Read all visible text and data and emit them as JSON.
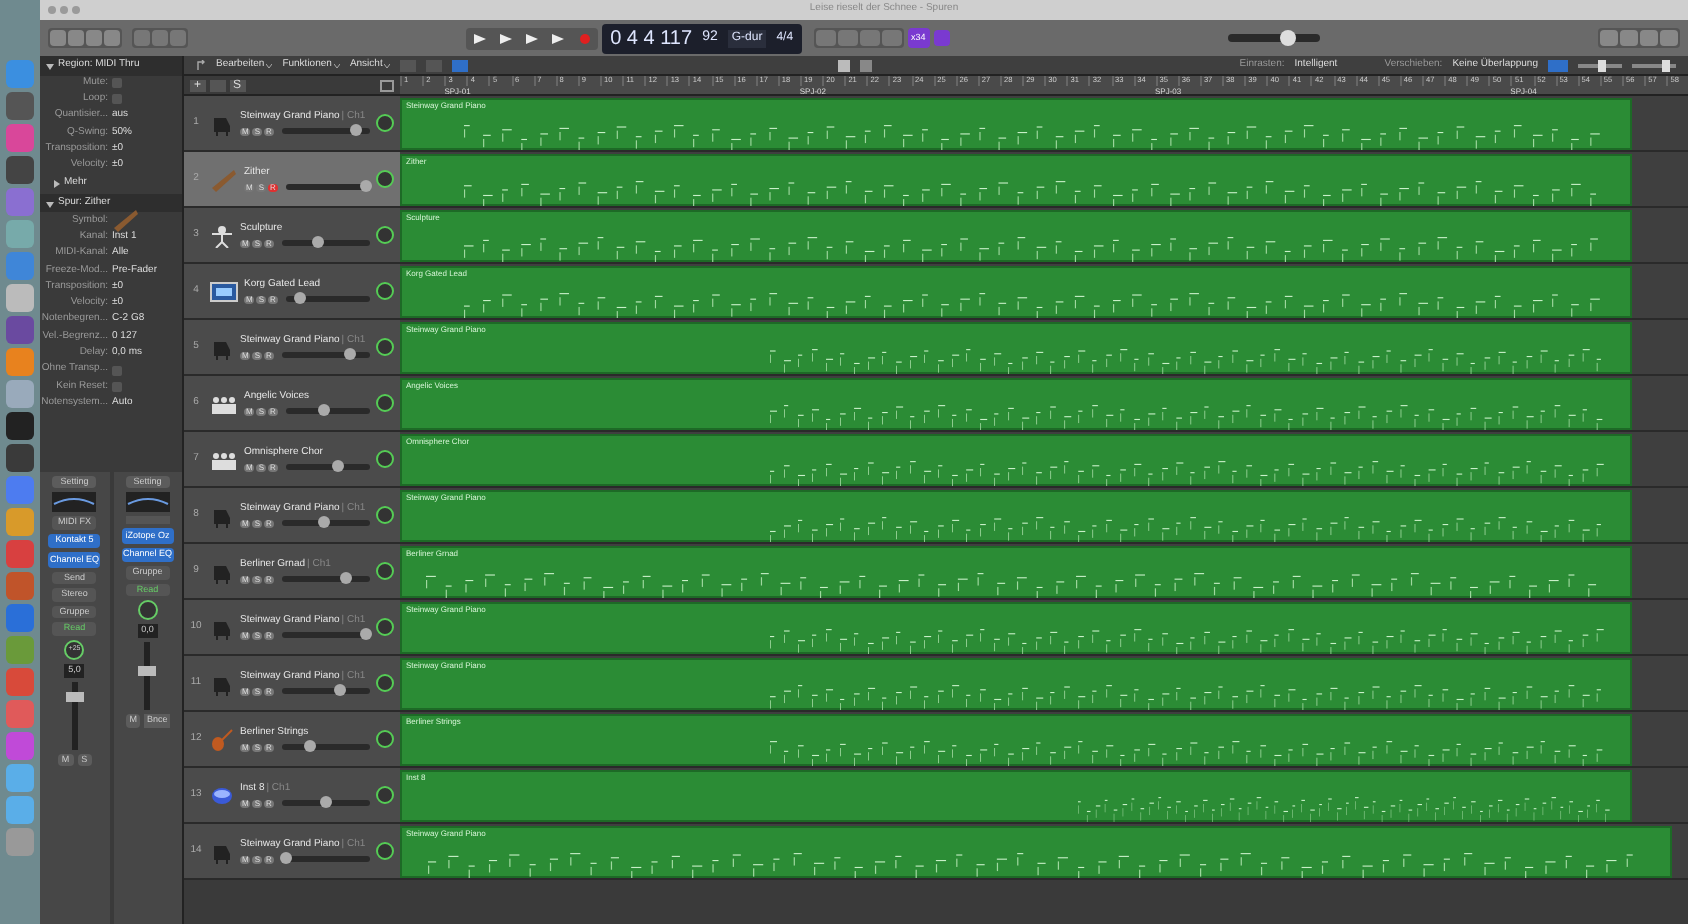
{
  "window": {
    "title": "Leise rieselt der Schnee - Spuren"
  },
  "lcd": {
    "position": "0 4 4 117",
    "tempo": "92",
    "key": "G-dur",
    "signature": "4/4"
  },
  "toolbar_badge": "x34",
  "master_volume": {
    "level": 0.65
  },
  "zoom_sliders": [
    {
      "level": 0.55
    },
    {
      "level": 0.75
    }
  ],
  "edit_bar": {
    "menus": [
      "Bearbeiten",
      "Funktionen",
      "Ansicht"
    ],
    "snap_label": "Einrasten:",
    "snap_value": "Intelligent",
    "drag_label": "Verschieben:",
    "drag_value": "Keine Überlappung"
  },
  "track_header_bar": {
    "add_label": "+",
    "solo_label": "S"
  },
  "ruler": {
    "bars": [
      "1",
      "2",
      "3",
      "4",
      "5",
      "6",
      "7",
      "8",
      "9",
      "10",
      "11",
      "12",
      "13",
      "14",
      "15",
      "16",
      "17",
      "18",
      "19",
      "20",
      "21",
      "22",
      "23",
      "24",
      "25",
      "26",
      "27",
      "28",
      "29",
      "30",
      "31",
      "32",
      "33",
      "34",
      "35",
      "36",
      "37",
      "38",
      "39",
      "40",
      "41",
      "42",
      "43",
      "44",
      "45",
      "46",
      "47",
      "48",
      "49",
      "50",
      "51",
      "52",
      "53",
      "54",
      "55",
      "56",
      "57",
      "58"
    ],
    "markers": [
      "SPJ-01",
      "SPJ-02",
      "SPJ-03",
      "SPJ-04"
    ]
  },
  "inspector": {
    "region_title": "Region: MIDI Thru",
    "region_rows": [
      {
        "label": "Mute:",
        "kind": "check",
        "checked": false
      },
      {
        "label": "Loop:",
        "kind": "check",
        "checked": false
      },
      {
        "label": "Quantisier...",
        "kind": "select",
        "value": "aus"
      },
      {
        "label": "Q-Swing:",
        "kind": "text",
        "value": "50%"
      },
      {
        "label": "Transposition:",
        "kind": "select",
        "value": "±0"
      },
      {
        "label": "Velocity:",
        "kind": "text",
        "value": "±0"
      }
    ],
    "more": "Mehr",
    "track_title": "Spur: Zither",
    "track_rows": [
      {
        "label": "Symbol:",
        "kind": "icon"
      },
      {
        "label": "Kanal:",
        "kind": "select",
        "value": "Inst 1"
      },
      {
        "label": "MIDI-Kanal:",
        "kind": "select",
        "value": "Alle"
      },
      {
        "label": "Freeze-Mod...",
        "kind": "select",
        "value": "Pre-Fader"
      },
      {
        "label": "Transposition:",
        "kind": "select",
        "value": "±0"
      },
      {
        "label": "Velocity:",
        "kind": "text",
        "value": "±0"
      },
      {
        "label": "Notenbegren...",
        "kind": "text",
        "value": "C-2   G8"
      },
      {
        "label": "Vel.-Begrenz...",
        "kind": "text",
        "value": "0   127"
      },
      {
        "label": "Delay:",
        "kind": "text",
        "value": "0,0 ms"
      },
      {
        "label": "Ohne Transp...",
        "kind": "check",
        "checked": false
      },
      {
        "label": "Kein Reset:",
        "kind": "check",
        "checked": false
      },
      {
        "label": "Notensystem...",
        "kind": "select",
        "value": "Auto"
      }
    ]
  },
  "channel_strips": [
    {
      "setting": "Setting",
      "midi_fx": "MIDI FX",
      "plugins": [
        "Kontakt 5",
        "Channel EQ"
      ],
      "send": "Send",
      "output": "Stereo",
      "group": "Gruppe",
      "automation": "Read",
      "pan_value": "+25",
      "volume": "5,0",
      "level": 0.8,
      "buttons": [
        "M",
        "S"
      ]
    },
    {
      "setting": "Setting",
      "plugins": [
        "iZotope Oz",
        "Channel EQ"
      ],
      "group": "Gruppe",
      "automation": "Read",
      "volume": "0,0",
      "level": 0.6,
      "buttons": [
        "M"
      ],
      "footer": "Bnce"
    }
  ],
  "tracks": [
    {
      "number": "1",
      "name": "Steinway Grand Piano",
      "channel": "| Ch1",
      "kind": "piano",
      "buttons": [
        "M",
        "S",
        "R"
      ],
      "level": 0.85,
      "selected": false,
      "record": false,
      "region": "Steinway Grand Piano"
    },
    {
      "number": "2",
      "name": "Zither",
      "kind": "zither",
      "buttons": [
        "M",
        "S",
        "R"
      ],
      "level": 0.95,
      "selected": true,
      "record": true,
      "region": "Zither"
    },
    {
      "number": "3",
      "name": "Sculpture",
      "kind": "synth",
      "buttons": [
        "M",
        "S",
        "R"
      ],
      "level": 0.4,
      "selected": false,
      "record": false,
      "region": "Sculpture"
    },
    {
      "number": "4",
      "name": "Korg Gated Lead",
      "kind": "keyboard",
      "buttons": [
        "M",
        "S",
        "R"
      ],
      "level": 0.17,
      "selected": false,
      "record": false,
      "region": "Korg Gated Lead"
    },
    {
      "number": "5",
      "name": "Steinway Grand Piano",
      "channel": "| Ch1",
      "kind": "piano",
      "buttons": [
        "M",
        "S",
        "R"
      ],
      "level": 0.78,
      "selected": false,
      "record": false,
      "region": "Steinway Grand Piano"
    },
    {
      "number": "6",
      "name": "Angelic Voices",
      "kind": "choir",
      "buttons": [
        "M",
        "S",
        "R"
      ],
      "level": 0.45,
      "selected": false,
      "record": false,
      "region": "Angelic Voices"
    },
    {
      "number": "7",
      "name": "Omnisphere Chor",
      "kind": "choir",
      "buttons": [
        "M",
        "S",
        "R"
      ],
      "level": 0.63,
      "selected": false,
      "record": false,
      "region": "Omnisphere Chor"
    },
    {
      "number": "8",
      "name": "Steinway Grand Piano",
      "channel": "| Ch1",
      "kind": "piano",
      "buttons": [
        "M",
        "S",
        "R"
      ],
      "level": 0.48,
      "selected": false,
      "record": false,
      "region": "Steinway Grand Piano"
    },
    {
      "number": "9",
      "name": "Berliner Grnad",
      "channel": "| Ch1",
      "kind": "piano",
      "buttons": [
        "M",
        "S",
        "R"
      ],
      "level": 0.72,
      "selected": false,
      "record": false,
      "region": "Berliner Grnad"
    },
    {
      "number": "10",
      "name": "Steinway Grand Piano",
      "channel": "| Ch1",
      "kind": "piano",
      "buttons": [
        "M",
        "S",
        "R"
      ],
      "level": 0.96,
      "selected": false,
      "record": false,
      "region": "Steinway Grand Piano"
    },
    {
      "number": "11",
      "name": "Steinway Grand Piano",
      "channel": "| Ch1",
      "kind": "piano",
      "buttons": [
        "M",
        "S",
        "R"
      ],
      "level": 0.65,
      "selected": false,
      "record": false,
      "region": "Steinway Grand Piano"
    },
    {
      "number": "12",
      "name": "Berliner Strings",
      "kind": "violin",
      "buttons": [
        "M",
        "S",
        "R"
      ],
      "level": 0.32,
      "selected": false,
      "record": false,
      "region": "Berliner Strings"
    },
    {
      "number": "13",
      "name": "Inst 8",
      "channel": "| Ch1",
      "kind": "drums",
      "buttons": [
        "M",
        "S",
        "R"
      ],
      "level": 0.5,
      "selected": false,
      "record": false,
      "region": "Inst 8"
    },
    {
      "number": "14",
      "name": "Steinway Grand Piano",
      "channel": "| Ch1",
      "kind": "piano",
      "buttons": [
        "M",
        "S",
        "R"
      ],
      "level": 0.04,
      "selected": false,
      "record": false,
      "region": "Steinway Grand Piano"
    }
  ]
}
